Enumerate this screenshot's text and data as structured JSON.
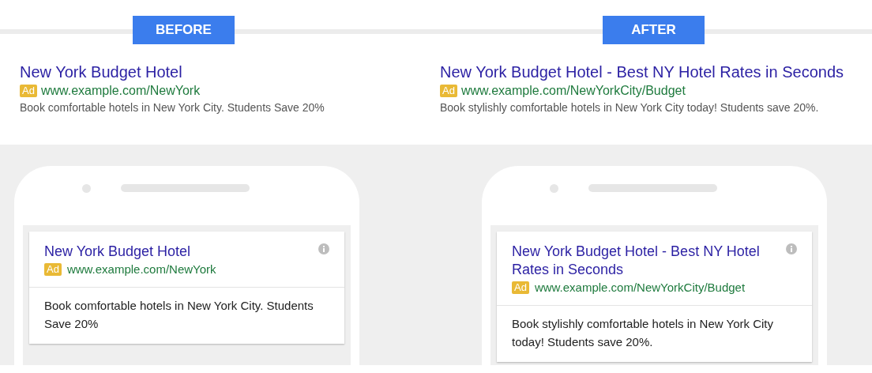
{
  "panels": [
    {
      "label": "BEFORE",
      "search_ad": {
        "title": "New York Budget Hotel",
        "badge": "Ad",
        "url": "www.example.com/NewYork",
        "description": "Book comfortable hotels in New York City. Students Save 20%"
      },
      "phone_ad": {
        "title": "New York Budget Hotel",
        "badge": "Ad",
        "url": "www.example.com/NewYork",
        "description": "Book comfortable hotels in New York City. Students Save 20%"
      }
    },
    {
      "label": "AFTER",
      "search_ad": {
        "title": "New York Budget Hotel - Best NY Hotel Rates in Seconds",
        "badge": "Ad",
        "url": "www.example.com/NewYorkCity/Budget",
        "description": "Book stylishly comfortable hotels in New York City today! Students save 20%."
      },
      "phone_ad": {
        "title": "New York Budget Hotel - Best NY Hotel Rates in Seconds",
        "badge": "Ad",
        "url": "www.example.com/NewYorkCity/Budget",
        "description": "Book stylishly comfortable hotels in New York City today! Students save 20%."
      }
    }
  ]
}
